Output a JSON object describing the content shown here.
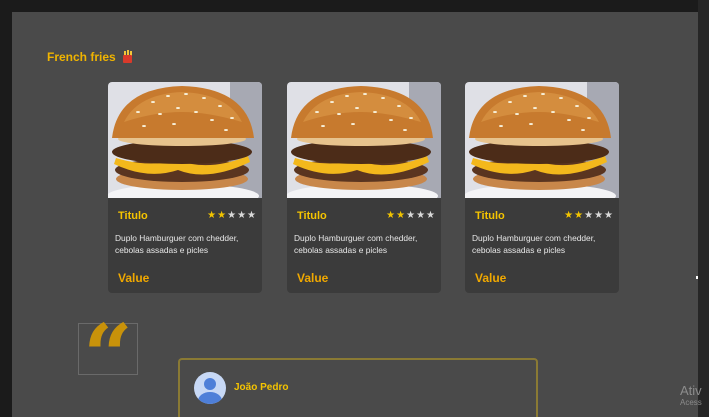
{
  "section": {
    "title": "French fries",
    "icon": "fries-icon"
  },
  "cards": [
    {
      "title": "Titulo",
      "rating": 2,
      "max_rating": 5,
      "description": "Duplo Hamburguer com chedder, cebolas assadas e picles",
      "value": "Value"
    },
    {
      "title": "Titulo",
      "rating": 2,
      "max_rating": 5,
      "description": "Duplo Hamburguer com chedder, cebolas assadas e picles",
      "value": "Value"
    },
    {
      "title": "Titulo",
      "rating": 2,
      "max_rating": 5,
      "description": "Duplo Hamburguer com chedder, cebolas assadas e picles",
      "value": "Value"
    }
  ],
  "testimonial": {
    "quote_icon": "quote-icon",
    "avatar_icon": "user-avatar-icon",
    "name": "João Pedro"
  },
  "watermark": {
    "line1": "Ativ",
    "line2": "Acess"
  },
  "colors": {
    "accent": "#f0b400",
    "background": "#4a4a4a",
    "card": "#3b3b3b",
    "star_on": "#f2c400",
    "star_off": "#d9d9d9"
  }
}
